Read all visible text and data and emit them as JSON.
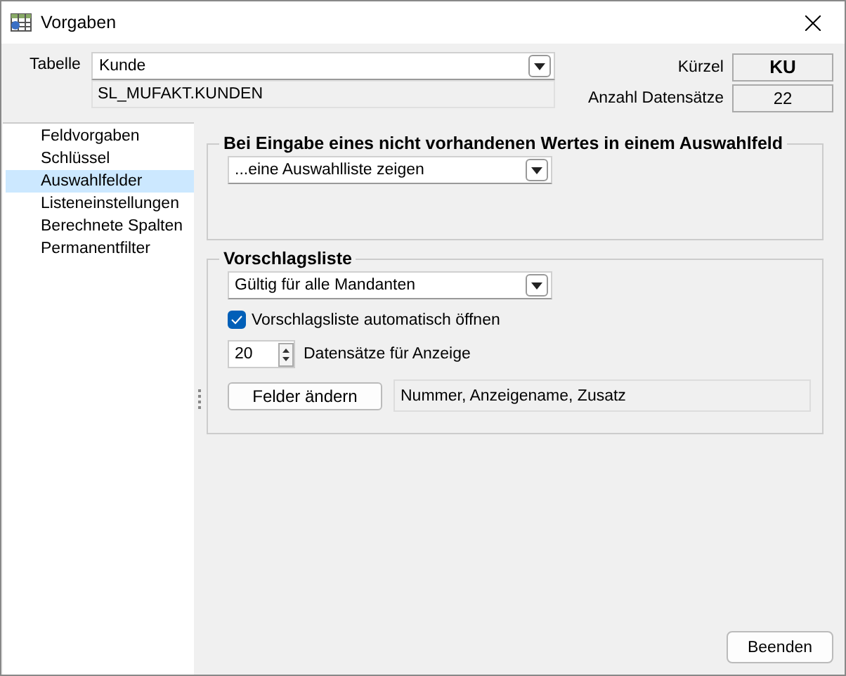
{
  "window": {
    "title": "Vorgaben"
  },
  "table_field": {
    "label": "Tabelle",
    "value": "Kunde",
    "source": "SL_MUFAKT.KUNDEN"
  },
  "info": [
    {
      "label": "Kürzel",
      "value": "KU",
      "bold": true
    },
    {
      "label": "Anzahl Datensätze",
      "value": "22",
      "bold": false
    }
  ],
  "sidebar": {
    "items": [
      {
        "label": "Feldvorgaben",
        "selected": false
      },
      {
        "label": "Schlüssel",
        "selected": false
      },
      {
        "label": "Auswahlfelder",
        "selected": true
      },
      {
        "label": "Listeneinstellungen",
        "selected": false
      },
      {
        "label": "Berechnete Spalten",
        "selected": false
      },
      {
        "label": "Permanentfilter",
        "selected": false
      }
    ]
  },
  "group_input": {
    "title": "Bei Eingabe eines nicht vorhandenen Wertes in einem Auswahlfeld",
    "dropdown": "...eine Auswahlliste zeigen"
  },
  "group_suggestions": {
    "title": "Vorschlagsliste",
    "dropdown": "Gültig für alle Mandanten",
    "checkbox": {
      "label": "Vorschlagsliste automatisch öffnen",
      "checked": true
    },
    "spinner": {
      "value": "20",
      "label": "Datensätze für Anzeige"
    },
    "fields_button": "Felder ändern",
    "fields_value": "Nummer, Anzeigename, Zusatz"
  },
  "buttons": [
    "Beenden"
  ]
}
